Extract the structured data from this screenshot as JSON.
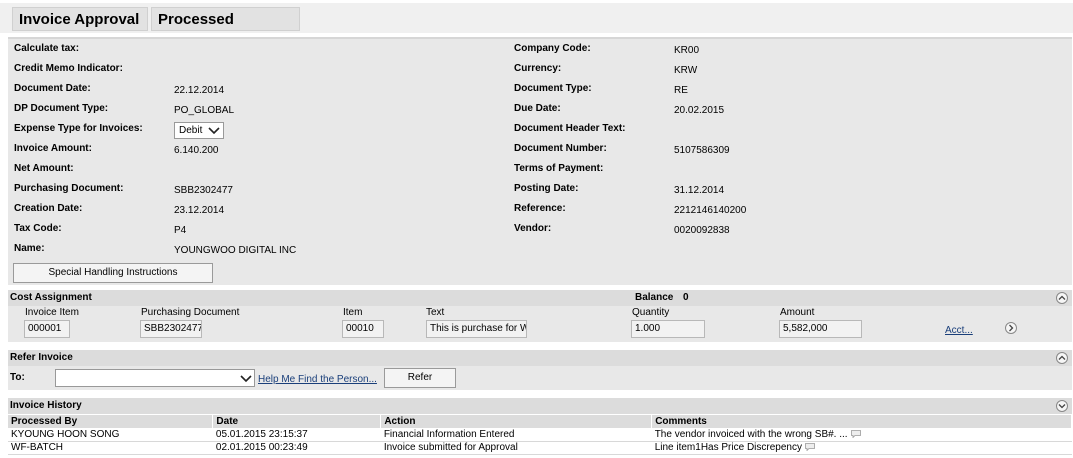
{
  "tabs": [
    {
      "label": "Invoice Approval"
    },
    {
      "label": "Processed Invoices"
    }
  ],
  "details": {
    "left": [
      {
        "label": "Calculate tax:",
        "value": ""
      },
      {
        "label": "Credit Memo Indicator:",
        "value": ""
      },
      {
        "label": "Document Date:",
        "value": "22.12.2014"
      },
      {
        "label": "DP Document Type:",
        "value": "PO_GLOBAL"
      },
      {
        "label": "Expense Type for Invoices:",
        "value": "Debit"
      },
      {
        "label": "Invoice Amount:",
        "value": "6.140.200"
      },
      {
        "label": "Net Amount:",
        "value": ""
      },
      {
        "label": "Purchasing Document:",
        "value": "SBB2302477"
      },
      {
        "label": "Creation Date:",
        "value": "23.12.2014"
      },
      {
        "label": "Tax Code:",
        "value": "P4"
      },
      {
        "label": "Name:",
        "value": "YOUNGWOO DIGITAL INC"
      }
    ],
    "right": [
      {
        "label": "Company Code:",
        "value": "KR00"
      },
      {
        "label": "Currency:",
        "value": "KRW"
      },
      {
        "label": "Document Type:",
        "value": "RE"
      },
      {
        "label": "Due Date:",
        "value": "20.02.2015"
      },
      {
        "label": "Document Header Text:",
        "value": ""
      },
      {
        "label": "Document Number:",
        "value": "5107586309"
      },
      {
        "label": "Terms of Payment:",
        "value": ""
      },
      {
        "label": "Posting Date:",
        "value": "31.12.2014"
      },
      {
        "label": "Reference:",
        "value": "2212146140200"
      },
      {
        "label": "Vendor:",
        "value": "0020092838"
      }
    ],
    "special_button": "Special Handling Instructions"
  },
  "cost_assignment": {
    "title": "Cost Assignment",
    "balance_label": "Balance",
    "balance_value": "0",
    "columns": [
      "Invoice Item",
      "Purchasing Document",
      "Item",
      "Text",
      "Quantity",
      "Amount"
    ],
    "row": {
      "invoice_item": "000001",
      "purchasing_document": "SBB2302477",
      "item": "00010",
      "text": "This is purchase for W",
      "quantity": "1.000",
      "amount": "5,582,000"
    },
    "acct_link": "Acct..."
  },
  "refer_invoice": {
    "title": "Refer Invoice",
    "to_label": "To:",
    "to_value": "",
    "help_link": "Help Me Find the Person...",
    "refer_button": "Refer"
  },
  "invoice_history": {
    "title": "Invoice History",
    "columns": [
      "Processed By",
      "Date",
      "Action",
      "Comments"
    ],
    "rows": [
      {
        "processed_by": "KYOUNG HOON SONG",
        "date": "05.01.2015 23:15:37",
        "action": "Financial Information Entered",
        "comments": "The vendor invoiced with the wrong SB#. ..."
      },
      {
        "processed_by": "WF-BATCH",
        "date": "02.01.2015 00:23:49",
        "action": "Invoice submitted for Approval",
        "comments": "Line item1Has Price Discrepency"
      }
    ]
  }
}
